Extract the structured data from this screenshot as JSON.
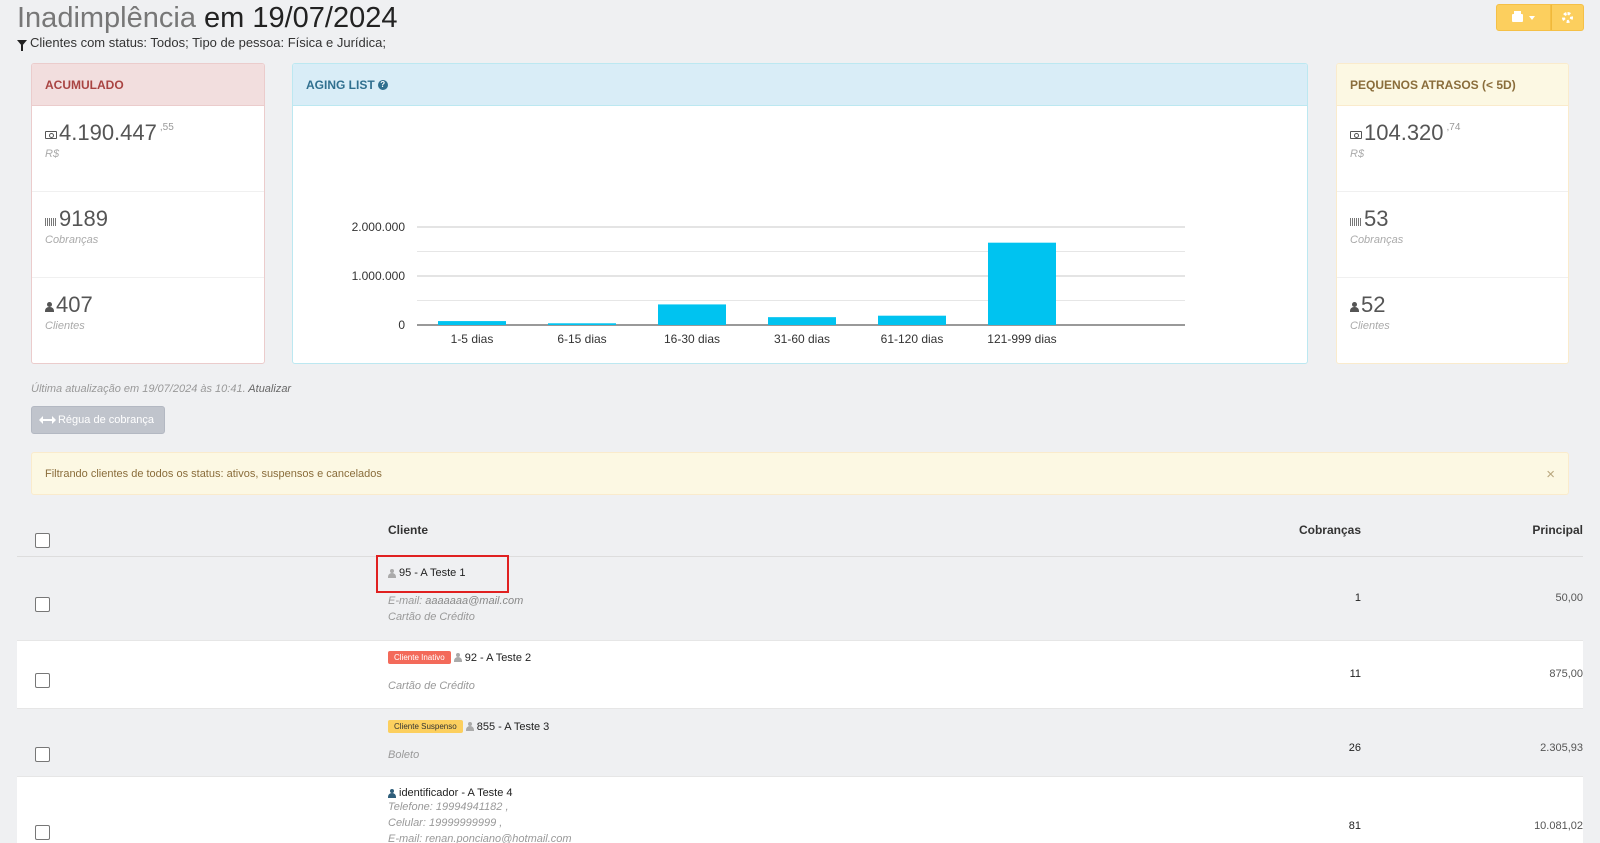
{
  "header": {
    "title_muted": "Inadimplência",
    "title_main": "em 19/07/2024",
    "filter_text": "Clientes com status: Todos; Tipo de pessoa: Física e Jurídica;"
  },
  "acumulado": {
    "title": "ACUMULADO",
    "amount_int": "4.190.447",
    "amount_cents": ",55",
    "amount_label": "R$",
    "charges": "9189",
    "charges_label": "Cobranças",
    "clients": "407",
    "clients_label": "Clientes"
  },
  "aging": {
    "title": "AGING LIST"
  },
  "chart_data": {
    "type": "bar",
    "categories": [
      "1-5 dias",
      "6-15 dias",
      "16-30 dias",
      "31-60 dias",
      "61-120 dias",
      "121-999 dias"
    ],
    "series": [
      {
        "name": "aging",
        "values": [
          80000,
          35000,
          420000,
          160000,
          190000,
          1680000
        ],
        "color": "#00c3f0"
      }
    ],
    "y_ticks": [
      "0",
      "1.000.000",
      "2.000.000"
    ],
    "ylim": [
      0,
      2000000
    ],
    "grid": true,
    "legend": "bottom"
  },
  "pequenos": {
    "title": "PEQUENOS ATRASOS (< 5D)",
    "amount_int": "104.320",
    "amount_cents": ",74",
    "amount_label": "R$",
    "charges": "53",
    "charges_label": "Cobranças",
    "clients": "52",
    "clients_label": "Clientes"
  },
  "update": {
    "text": "Última atualização em 19/07/2024 às 10:41.",
    "link": "Atualizar"
  },
  "regua_button": "Régua de cobrança",
  "alert": {
    "text": "Filtrando clientes de todos os status: ativos, suspensos e cancelados",
    "close": "×"
  },
  "table": {
    "col_client": "Cliente",
    "col_charges": "Cobranças",
    "col_principal": "Principal",
    "rows": [
      {
        "name": "95 - A Teste 1",
        "email_label": "E-mail:",
        "email": "aaaaaaa@mail.com",
        "payment": "Cartão de Crédito",
        "charges": "1",
        "principal": "50,00"
      },
      {
        "badge": "Cliente Inativo",
        "name": "92 - A Teste 2",
        "payment": "Cartão de Crédito",
        "charges": "11",
        "principal": "875,00"
      },
      {
        "badge": "Cliente Suspenso",
        "name": "855 - A Teste 3",
        "payment": "Boleto",
        "charges": "26",
        "principal": "2.305,93"
      },
      {
        "name": "identificador - A Teste 4",
        "phone": "Telefone: 19994941182 ,",
        "cell": "Celular: 19999999999 ,",
        "email_line": "E-mail: renan.ponciano@hotmail.com",
        "charges": "81",
        "principal": "10.081,02"
      }
    ]
  },
  "colors": {
    "accent": "#00c3f0",
    "warning": "#fccf5e",
    "danger": "#f36a5a"
  }
}
